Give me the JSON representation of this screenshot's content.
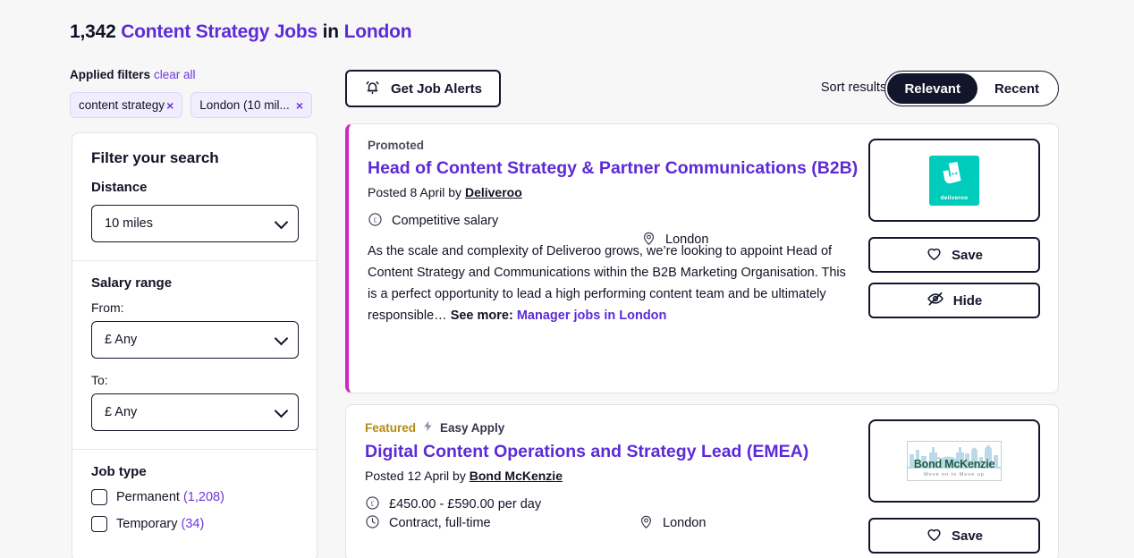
{
  "header": {
    "count": "1,342",
    "job_kind": "Content Strategy Jobs",
    "in_word": "in",
    "location": "London"
  },
  "applied_filters": {
    "label": "Applied filters",
    "clear_all": "clear all",
    "chips": [
      {
        "label": "content strategy",
        "remove": "×"
      },
      {
        "label": "London (10 mil...",
        "remove": "×"
      }
    ]
  },
  "sidebar": {
    "title": "Filter your search",
    "distance": {
      "label": "Distance",
      "value": "10 miles"
    },
    "salary": {
      "title": "Salary range",
      "from_label": "From:",
      "from_value": "£ Any",
      "to_label": "To:",
      "to_value": "£ Any"
    },
    "job_type": {
      "title": "Job type",
      "options": [
        {
          "label": "Permanent",
          "count": "(1,208)"
        },
        {
          "label": "Temporary",
          "count": "(34)"
        }
      ]
    }
  },
  "toolbar": {
    "alerts_label": "Get Job Alerts",
    "alerts_icon": "bell-icon",
    "sort_label": "Sort results by most",
    "sort_options": [
      {
        "label": "Relevant",
        "active": true
      },
      {
        "label": "Recent",
        "active": false
      }
    ]
  },
  "jobs": [
    {
      "badge": "Promoted",
      "title": "Head of Content Strategy & Partner Communications (B2B)",
      "posted_prefix": "Posted 8 April by ",
      "company": "Deliveroo",
      "salary": "Competitive salary",
      "location": "London",
      "description": "As the scale and complexity of Deliveroo grows, we’re looking to appoint Head of Content Strategy and Communications within the B2B Marketing Organisation. This is a perfect opportunity to lead a high performing content team and be ultimately responsible… ",
      "see_more_label": "See more:",
      "see_more_link": "Manager jobs in London",
      "logo_text": "deliveroo",
      "save_label": "Save",
      "hide_label": "Hide",
      "accent_color": "#cd2bc0"
    },
    {
      "badge": "Featured",
      "easy_apply": "Easy Apply",
      "title": "Digital Content Operations and Strategy Lead (EMEA)",
      "posted_prefix": "Posted 12 April by ",
      "company": "Bond McKenzie",
      "salary": "£450.00 - £590.00 per day",
      "location": "London",
      "contract": "Contract, full-time",
      "logo_name": "Bond McKenzie",
      "logo_tagline": "Move on to Move up",
      "save_label": "Save"
    }
  ],
  "colors": {
    "brand_purple": "#5d2bd6",
    "link_purple": "#6f35e0",
    "promoted_accent": "#cd2bc0",
    "featured_gold": "#b58a14",
    "deliveroo_teal": "#00ccbc",
    "dark": "#13152b"
  }
}
